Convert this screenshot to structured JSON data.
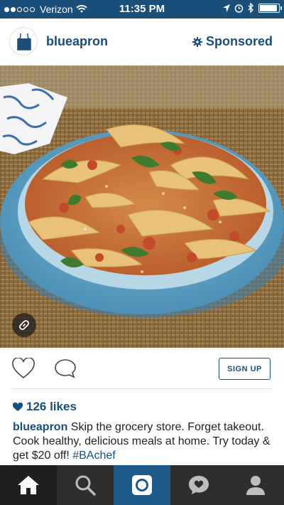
{
  "status_bar": {
    "carrier": "Verizon",
    "time": "11:35 PM",
    "signal_bars_filled": 2,
    "signal_bars_total": 5,
    "battery_level": 0.95
  },
  "post": {
    "username": "blueapron",
    "sponsored_label": "Sponsored",
    "signup_label": "SIGN UP",
    "likes": "126 likes",
    "caption_user": "blueapron",
    "caption_text": " Skip the grocery store. Forget takeout. Cook healthy, delicious meals at home. Try today & get $20 off! ",
    "caption_hashtag": "#BAchef"
  },
  "icons": {
    "avatar": "apron-logo-icon",
    "sponsored": "gear-icon",
    "link": "link-icon",
    "like": "heart-outline-icon",
    "comment": "comment-bubble-icon",
    "likes": "heart-filled-icon"
  },
  "tabs": [
    {
      "name": "home",
      "icon": "home-icon",
      "active": true
    },
    {
      "name": "search",
      "icon": "search-icon",
      "active": false
    },
    {
      "name": "camera",
      "icon": "camera-icon",
      "active": false
    },
    {
      "name": "activity",
      "icon": "activity-bubble-icon",
      "active": false
    },
    {
      "name": "profile",
      "icon": "person-icon",
      "active": false
    }
  ],
  "colors": {
    "brand_blue": "#1a4f7a",
    "tab_bar": "#2e2e2e",
    "camera_tab": "#1d5a8a"
  }
}
